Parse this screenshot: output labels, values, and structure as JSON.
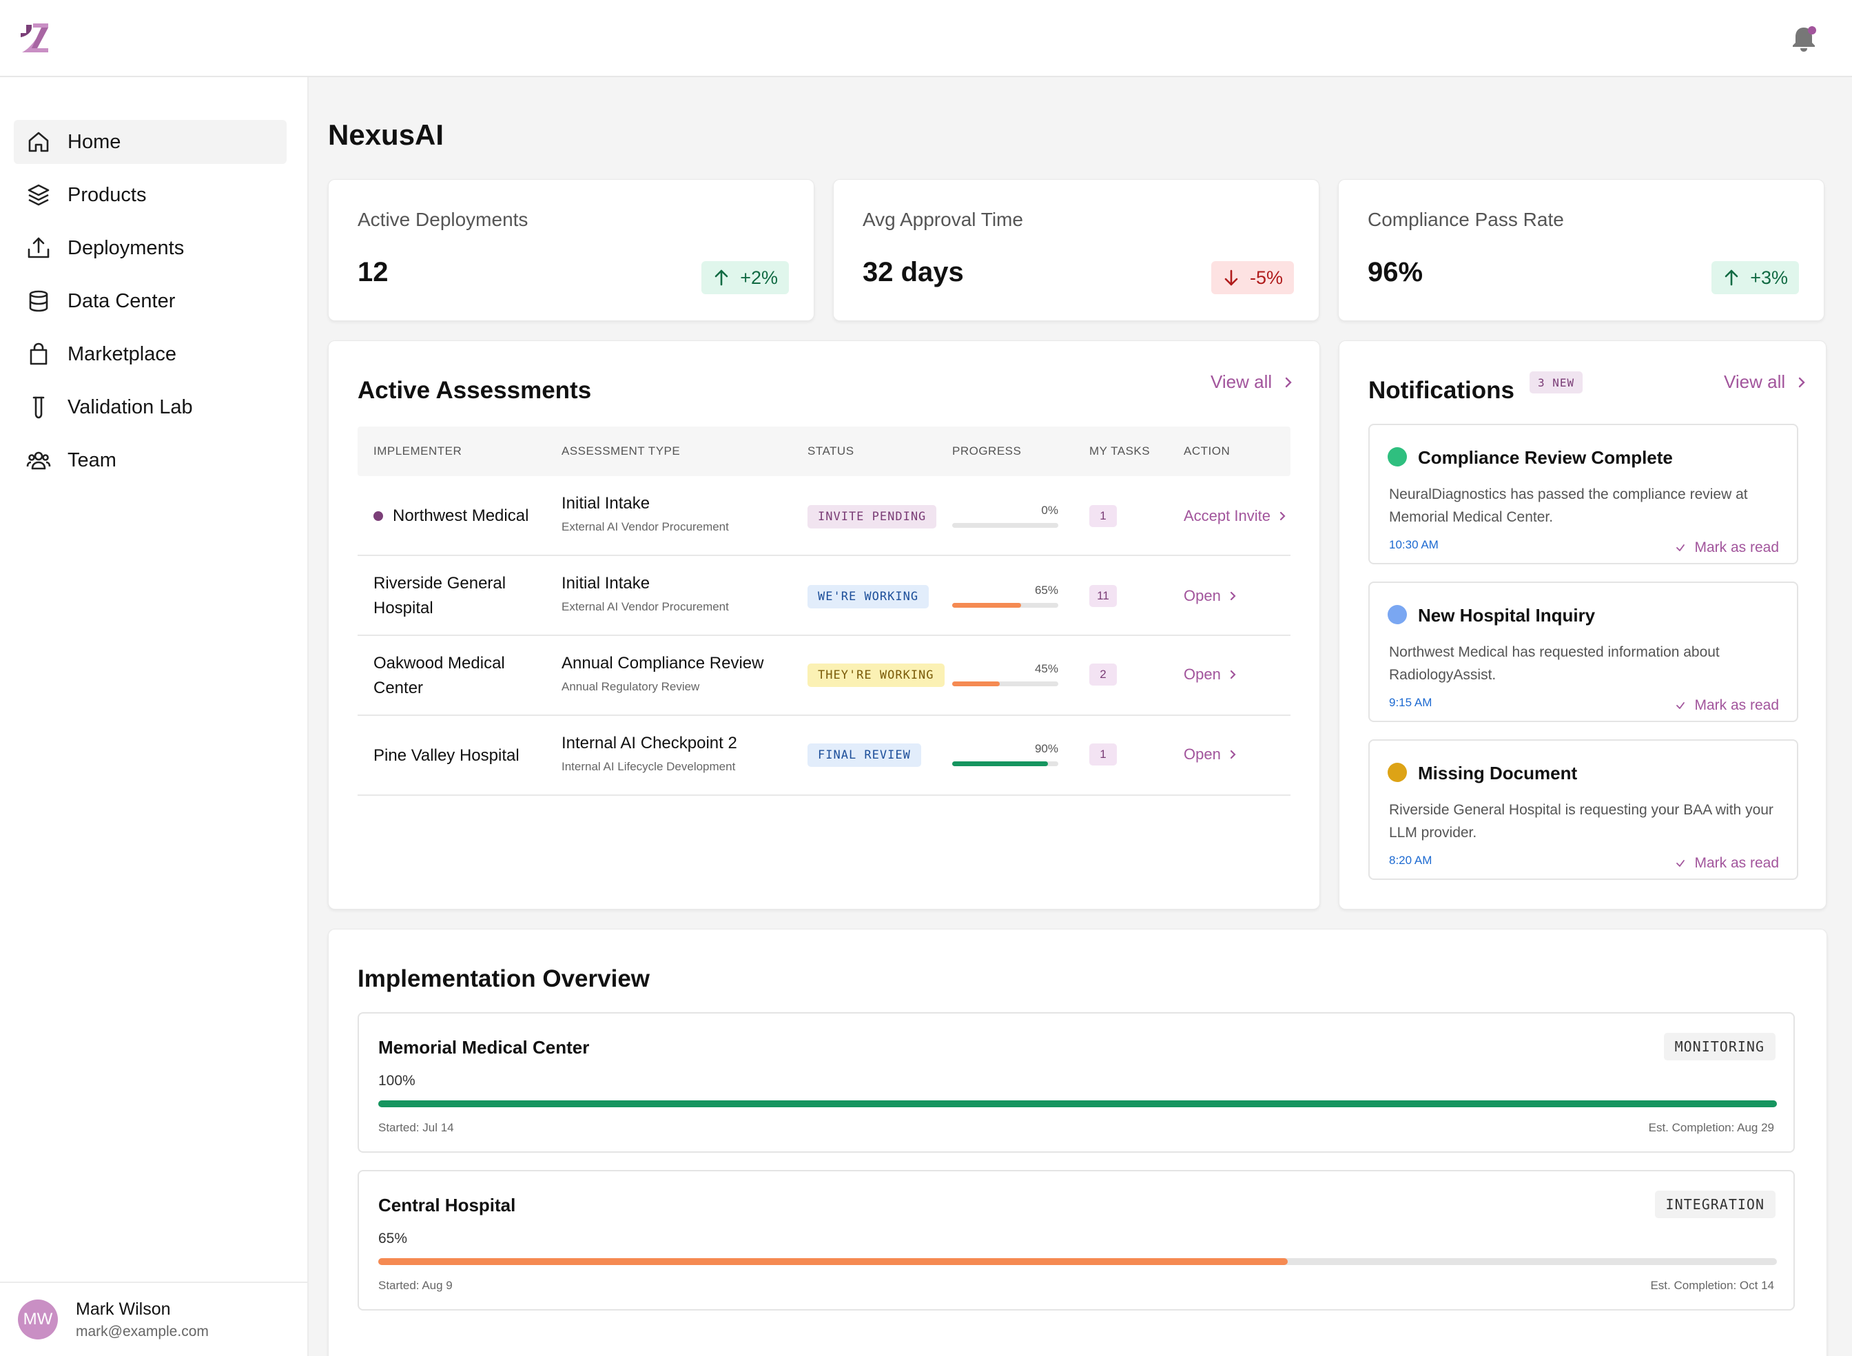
{
  "app": {
    "title": "NexusAI"
  },
  "user": {
    "initials": "MW",
    "name": "Mark Wilson",
    "email": "mark@example.com"
  },
  "sidebar": {
    "items": [
      {
        "label": "Home",
        "icon": "home-icon",
        "active": true
      },
      {
        "label": "Products",
        "icon": "layers-icon"
      },
      {
        "label": "Deployments",
        "icon": "upload-icon"
      },
      {
        "label": "Data Center",
        "icon": "database-icon"
      },
      {
        "label": "Marketplace",
        "icon": "shopping-bag-icon"
      },
      {
        "label": "Validation Lab",
        "icon": "test-tube-icon"
      },
      {
        "label": "Team",
        "icon": "users-icon"
      }
    ]
  },
  "stats": [
    {
      "label": "Active Deployments",
      "value": "12",
      "delta": "+2%",
      "direction": "up"
    },
    {
      "label": "Avg Approval Time",
      "value": "32 days",
      "delta": "-5%",
      "direction": "down"
    },
    {
      "label": "Compliance Pass Rate",
      "value": "96%",
      "delta": "+3%",
      "direction": "up"
    }
  ],
  "assessments": {
    "title": "Active Assessments",
    "view_all": "View all",
    "columns": [
      "IMPLEMENTER",
      "ASSESSMENT TYPE",
      "STATUS",
      "PROGRESS",
      "MY TASKS",
      "ACTION"
    ],
    "rows": [
      {
        "implementer": "Northwest Medical",
        "type": "Initial Intake",
        "subtype": "External AI Vendor Procurement",
        "status": "INVITE PENDING",
        "progress": 0,
        "progress_label": "0%",
        "tasks": "1",
        "action": "Accept Invite"
      },
      {
        "implementer": "Riverside General Hospital",
        "type": "Initial Intake",
        "subtype": "External AI Vendor Procurement",
        "status": "WE'RE WORKING",
        "progress": 65,
        "progress_label": "65%",
        "tasks": "11",
        "action": "Open"
      },
      {
        "implementer": "Oakwood Medical Center",
        "type": "Annual Compliance Review",
        "subtype": "Annual Regulatory Review",
        "status": "THEY'RE WORKING",
        "progress": 45,
        "progress_label": "45%",
        "tasks": "2",
        "action": "Open"
      },
      {
        "implementer": "Pine Valley Hospital",
        "type": "Internal AI Checkpoint 2",
        "subtype": "Internal AI Lifecycle Development",
        "status": "FINAL REVIEW",
        "progress": 90,
        "progress_label": "90%",
        "tasks": "1",
        "action": "Open"
      }
    ]
  },
  "notifications": {
    "title": "Notifications",
    "badge": "3 NEW",
    "view_all": "View all",
    "items": [
      {
        "title": "Compliance Review Complete",
        "body": "NeuralDiagnostics has passed the compliance review at Memorial Medical Center.",
        "time": "10:30 AM",
        "mark": "Mark as read",
        "color": "#2fbf7f"
      },
      {
        "title": "New Hospital Inquiry",
        "body": "Northwest Medical has requested information about RadiologyAssist.",
        "time": "9:15 AM",
        "mark": "Mark as read",
        "color": "#7aa7f2"
      },
      {
        "title": "Missing Document",
        "body": "Riverside General Hospital is requesting your BAA with your LLM provider.",
        "time": "8:20 AM",
        "mark": "Mark as read",
        "color": "#dda316"
      }
    ]
  },
  "implementation": {
    "title": "Implementation Overview",
    "items": [
      {
        "name": "Memorial Medical Center",
        "stage": "MONITORING",
        "progress": 100,
        "progress_label": "100%",
        "started": "Started: Jul 14",
        "est": "Est. Completion: Aug 29",
        "color": "#16955f"
      },
      {
        "name": "Central Hospital",
        "stage": "INTEGRATION",
        "progress": 65,
        "progress_label": "65%",
        "started": "Started: Aug 9",
        "est": "Est. Completion: Oct 14",
        "color": "#f58a52"
      }
    ]
  },
  "colors": {
    "accent": "#a2559c",
    "green": "#16955f",
    "orange": "#f58a52"
  }
}
